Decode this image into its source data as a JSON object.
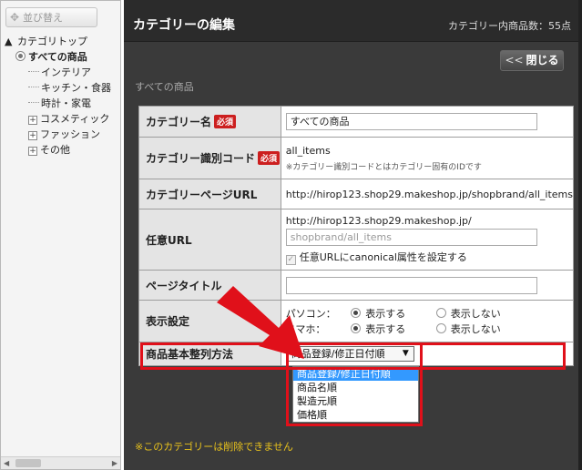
{
  "sidebar": {
    "sort_button_label": "並び替え",
    "tree": {
      "root": "カテゴリトップ",
      "selected": "すべての商品",
      "children": [
        "インテリア",
        "キッチン・食器",
        "時計・家電"
      ],
      "expandable": [
        "コスメティック",
        "ファッション",
        "その他"
      ]
    }
  },
  "header": {
    "title": "カテゴリーの編集",
    "item_count": "カテゴリー内商品数：55点",
    "close_label": "閉じる",
    "breadcrumb": "すべての商品"
  },
  "form": {
    "required_badge": "必須",
    "name_label": "カテゴリー名",
    "name_value": "すべての商品",
    "code_label": "カテゴリー識別コード",
    "code_value": "all_items",
    "code_note": "※カテゴリー識別コードとはカテゴリー固有のIDです",
    "page_url_label": "カテゴリーページURL",
    "page_url_value": "http://hirop123.shop29.makeshop.jp/shopbrand/all_items",
    "custom_url_label": "任意URL",
    "custom_url_prefix": "http://hirop123.shop29.makeshop.jp/",
    "custom_url_value": "shopbrand/all_items",
    "canonical_label": "任意URLにcanonical属性を設定する",
    "page_title_label": "ページタイトル",
    "page_title_value": "",
    "display_label": "表示設定",
    "display_rows": [
      {
        "device": "パソコン：",
        "show": "表示する",
        "hide": "表示しない"
      },
      {
        "device": "スマホ：",
        "show": "表示する",
        "hide": "表示しない"
      }
    ],
    "sort_label": "商品基本整列方法",
    "sort_selected": "商品登録/修正日付順",
    "sort_options": [
      "商品登録/修正日付順",
      "商品名順",
      "製造元順",
      "価格順"
    ]
  },
  "footer": {
    "warning": "※このカテゴリーは削除できません"
  },
  "colors": {
    "highlight": "#e0101a",
    "warning_text": "#e8c21c",
    "selected_option": "#3399ff"
  }
}
